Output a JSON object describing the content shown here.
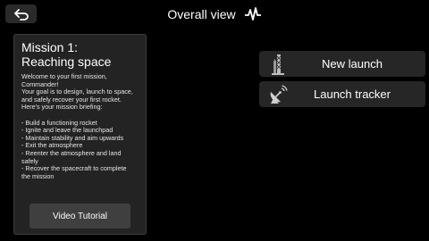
{
  "header": {
    "title": "Overall view",
    "back_icon": "back-arrow-icon",
    "status_icon": "activity-pulse-icon"
  },
  "mission": {
    "title_line1": "Mission 1:",
    "title_line2": "Reaching space",
    "intro": "Welcome to your first mission,\nCommander!\nYour goal is to design, launch to space,\nand safely recover your first rocket.\nHere's your mission briefing:",
    "briefing": [
      "- Build a functioning rocket",
      "- Ignite and leave the launchpad",
      "- Maintain stability and aim upwards",
      "- Exit the atmosphere",
      "- Reenter the atmosphere and land\nsafely",
      "- Recover the spacecraft to complete\nthe mission"
    ],
    "video_button": "Video Tutorial"
  },
  "actions": {
    "new_launch": {
      "label": "New launch",
      "icon": "launch-tower-icon"
    },
    "launch_tracker": {
      "label": "Launch tracker",
      "icon": "satellite-dish-icon"
    }
  }
}
